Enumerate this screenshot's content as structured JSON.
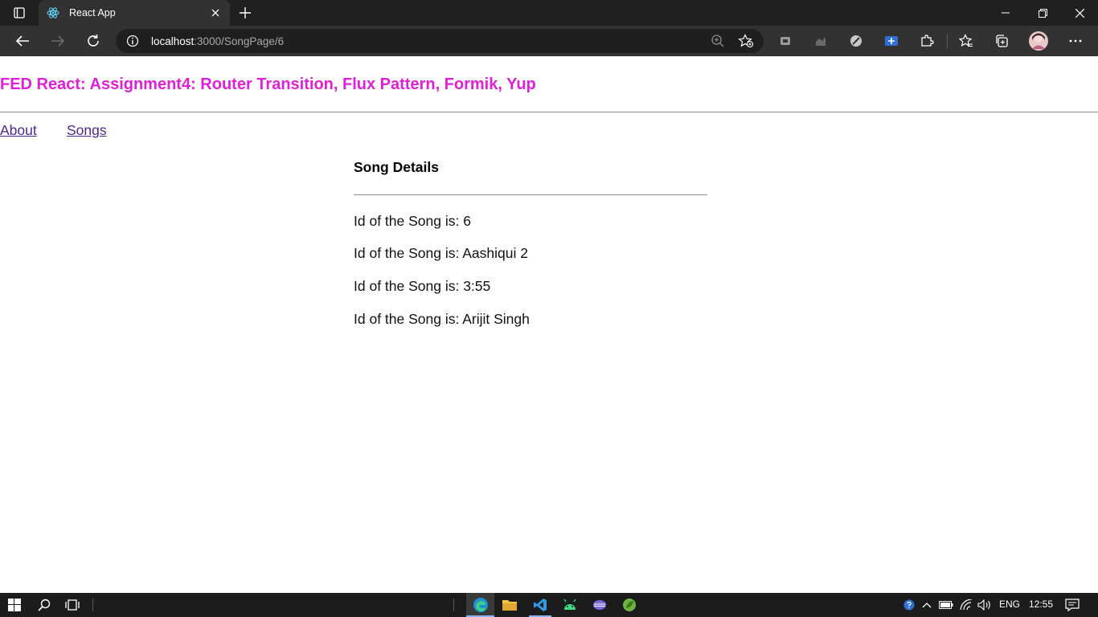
{
  "browser": {
    "tab_title": "React App",
    "url_host": "localhost",
    "url_path": ":3000/SongPage/6"
  },
  "page": {
    "title": "FED React: Assignment4: Router Transition, Flux Pattern, Formik, Yup",
    "nav": {
      "about": "About",
      "songs": "Songs"
    },
    "details": {
      "heading": "Song Details",
      "lines": [
        "Id of the Song is: 6",
        "Id of the Song is: Aashiqui 2",
        "Id of the Song is: 3:55",
        "Id of the Song is: Arijit Singh"
      ]
    }
  },
  "taskbar": {
    "language": "ENG",
    "time": "12:55"
  },
  "colors": {
    "title": "#e020d8",
    "link": "#4a2a8c",
    "chrome_dark": "#202020",
    "toolbar": "#323232"
  }
}
